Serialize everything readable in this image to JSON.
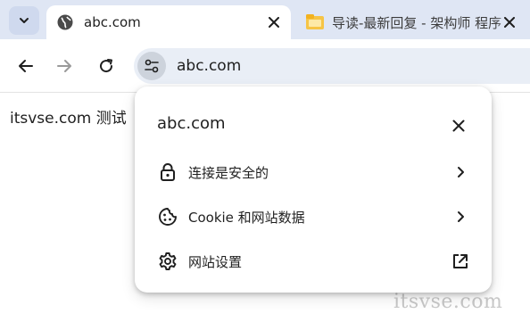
{
  "tabs": [
    {
      "title": "abc.com",
      "active": true,
      "favicon": "globe-icon"
    },
    {
      "title": "导读-最新回复 - 架构师 程序",
      "active": false,
      "favicon": "folder-icon"
    }
  ],
  "toolbar": {
    "back": "back-arrow-icon",
    "forward": "forward-arrow-icon",
    "reload": "reload-icon",
    "url": "abc.com"
  },
  "page": {
    "text": "itsvse.com 测试"
  },
  "popup": {
    "title": "abc.com",
    "items": [
      {
        "label": "连接是安全的",
        "icon": "lock-icon",
        "action": "chevron-right-icon"
      },
      {
        "label": "Cookie 和网站数据",
        "icon": "cookie-icon",
        "action": "chevron-right-icon"
      },
      {
        "label": "网站设置",
        "icon": "gear-icon",
        "action": "open-external-icon"
      }
    ]
  },
  "watermark": "itsvse.com",
  "colors": {
    "tabstrip": "#dfe6f4",
    "omnibox": "#e9eef6",
    "text": "#1f1f1f"
  }
}
